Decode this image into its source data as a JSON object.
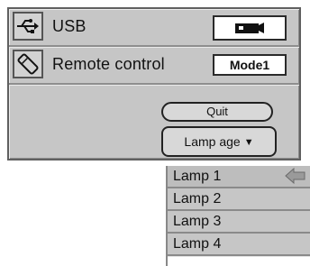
{
  "settings": {
    "usb": {
      "label": "USB",
      "icon": "usb-icon",
      "value_icon": "camera-icon"
    },
    "remote": {
      "label": "Remote control",
      "icon": "remote-icon",
      "value": "Mode1"
    },
    "quit_label": "Quit",
    "lamp_age_label": "Lamp age"
  },
  "lamp_menu": {
    "items": [
      "Lamp 1",
      "Lamp 2",
      "Lamp 3",
      "Lamp 4"
    ],
    "selected_index": 0
  }
}
